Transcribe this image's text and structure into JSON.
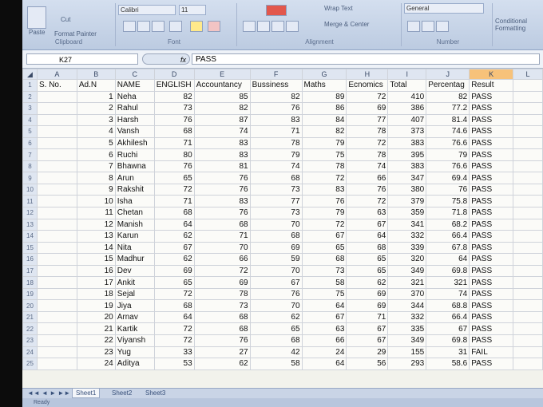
{
  "ribbon": {
    "paste": "Paste",
    "cut": "Cut",
    "format_painter": "Format Painter",
    "clipboard": "Clipboard",
    "font_name": "Calibri",
    "font_size": "11",
    "font_group": "Font",
    "wrap_text": "Wrap Text",
    "merge_center": "Merge & Center",
    "alignment": "Alignment",
    "number_format": "General",
    "number_group": "Number",
    "conditional_formatting": "Conditional Formatting"
  },
  "formula_bar": {
    "cell_ref": "K27",
    "fx": "fx",
    "content": "PASS"
  },
  "sheet": {
    "columns": [
      "A",
      "B",
      "C",
      "D",
      "E",
      "F",
      "G",
      "H",
      "I",
      "J",
      "K",
      "L"
    ],
    "selected_column": "K",
    "rows": [
      {
        "n": "1",
        "a": "S. No.",
        "b": "Ad.N",
        "c": "NAME",
        "d": "ENGLISH",
        "e": "Accountancy",
        "f": "Bussiness",
        "g": "Maths",
        "h": "Ecnomics",
        "i": "Total",
        "j": "Percentag",
        "k": "Result"
      },
      {
        "n": "2",
        "a": "",
        "b": "1",
        "c": "Neha",
        "d": "82",
        "e": "85",
        "f": "82",
        "g": "89",
        "h": "72",
        "i": "410",
        "j": "82",
        "k": "PASS"
      },
      {
        "n": "3",
        "a": "",
        "b": "2",
        "c": "Rahul",
        "d": "73",
        "e": "82",
        "f": "76",
        "g": "86",
        "h": "69",
        "i": "386",
        "j": "77.2",
        "k": "PASS"
      },
      {
        "n": "4",
        "a": "",
        "b": "3",
        "c": "Harsh",
        "d": "76",
        "e": "87",
        "f": "83",
        "g": "84",
        "h": "77",
        "i": "407",
        "j": "81.4",
        "k": "PASS"
      },
      {
        "n": "5",
        "a": "",
        "b": "4",
        "c": "Vansh",
        "d": "68",
        "e": "74",
        "f": "71",
        "g": "82",
        "h": "78",
        "i": "373",
        "j": "74.6",
        "k": "PASS"
      },
      {
        "n": "6",
        "a": "",
        "b": "5",
        "c": "Akhilesh",
        "d": "71",
        "e": "83",
        "f": "78",
        "g": "79",
        "h": "72",
        "i": "383",
        "j": "76.6",
        "k": "PASS"
      },
      {
        "n": "7",
        "a": "",
        "b": "6",
        "c": "Ruchi",
        "d": "80",
        "e": "83",
        "f": "79",
        "g": "75",
        "h": "78",
        "i": "395",
        "j": "79",
        "k": "PASS"
      },
      {
        "n": "8",
        "a": "",
        "b": "7",
        "c": "Bhawna",
        "d": "76",
        "e": "81",
        "f": "74",
        "g": "78",
        "h": "74",
        "i": "383",
        "j": "76.6",
        "k": "PASS"
      },
      {
        "n": "9",
        "a": "",
        "b": "8",
        "c": "Arun",
        "d": "65",
        "e": "76",
        "f": "68",
        "g": "72",
        "h": "66",
        "i": "347",
        "j": "69.4",
        "k": "PASS"
      },
      {
        "n": "10",
        "a": "",
        "b": "9",
        "c": "Rakshit",
        "d": "72",
        "e": "76",
        "f": "73",
        "g": "83",
        "h": "76",
        "i": "380",
        "j": "76",
        "k": "PASS"
      },
      {
        "n": "11",
        "a": "",
        "b": "10",
        "c": "Isha",
        "d": "71",
        "e": "83",
        "f": "77",
        "g": "76",
        "h": "72",
        "i": "379",
        "j": "75.8",
        "k": "PASS"
      },
      {
        "n": "12",
        "a": "",
        "b": "11",
        "c": "Chetan",
        "d": "68",
        "e": "76",
        "f": "73",
        "g": "79",
        "h": "63",
        "i": "359",
        "j": "71.8",
        "k": "PASS"
      },
      {
        "n": "13",
        "a": "",
        "b": "12",
        "c": "Manish",
        "d": "64",
        "e": "68",
        "f": "70",
        "g": "72",
        "h": "67",
        "i": "341",
        "j": "68.2",
        "k": "PASS"
      },
      {
        "n": "14",
        "a": "",
        "b": "13",
        "c": "Karun",
        "d": "62",
        "e": "71",
        "f": "68",
        "g": "67",
        "h": "64",
        "i": "332",
        "j": "66.4",
        "k": "PASS"
      },
      {
        "n": "15",
        "a": "",
        "b": "14",
        "c": "Nita",
        "d": "67",
        "e": "70",
        "f": "69",
        "g": "65",
        "h": "68",
        "i": "339",
        "j": "67.8",
        "k": "PASS"
      },
      {
        "n": "16",
        "a": "",
        "b": "15",
        "c": "Madhur",
        "d": "62",
        "e": "66",
        "f": "59",
        "g": "68",
        "h": "65",
        "i": "320",
        "j": "64",
        "k": "PASS"
      },
      {
        "n": "17",
        "a": "",
        "b": "16",
        "c": "Dev",
        "d": "69",
        "e": "72",
        "f": "70",
        "g": "73",
        "h": "65",
        "i": "349",
        "j": "69.8",
        "k": "PASS"
      },
      {
        "n": "18",
        "a": "",
        "b": "17",
        "c": "Ankit",
        "d": "65",
        "e": "69",
        "f": "67",
        "g": "58",
        "h": "62",
        "i": "321",
        "j": "321",
        "k": "PASS"
      },
      {
        "n": "19",
        "a": "",
        "b": "18",
        "c": "Sejal",
        "d": "72",
        "e": "78",
        "f": "76",
        "g": "75",
        "h": "69",
        "i": "370",
        "j": "74",
        "k": "PASS"
      },
      {
        "n": "20",
        "a": "",
        "b": "19",
        "c": "Jiya",
        "d": "68",
        "e": "73",
        "f": "70",
        "g": "64",
        "h": "69",
        "i": "344",
        "j": "68.8",
        "k": "PASS"
      },
      {
        "n": "21",
        "a": "",
        "b": "20",
        "c": "Arnav",
        "d": "64",
        "e": "68",
        "f": "62",
        "g": "67",
        "h": "71",
        "i": "332",
        "j": "66.4",
        "k": "PASS"
      },
      {
        "n": "22",
        "a": "",
        "b": "21",
        "c": "Kartik",
        "d": "72",
        "e": "68",
        "f": "65",
        "g": "63",
        "h": "67",
        "i": "335",
        "j": "67",
        "k": "PASS"
      },
      {
        "n": "23",
        "a": "",
        "b": "22",
        "c": "Viyansh",
        "d": "72",
        "e": "76",
        "f": "68",
        "g": "66",
        "h": "67",
        "i": "349",
        "j": "69.8",
        "k": "PASS"
      },
      {
        "n": "24",
        "a": "",
        "b": "23",
        "c": "Yug",
        "d": "33",
        "e": "27",
        "f": "42",
        "g": "24",
        "h": "29",
        "i": "155",
        "j": "31",
        "k": "FAIL"
      },
      {
        "n": "25",
        "a": "",
        "b": "24",
        "c": "Aditya",
        "d": "53",
        "e": "62",
        "f": "58",
        "g": "64",
        "h": "56",
        "i": "293",
        "j": "58.6",
        "k": "PASS"
      }
    ]
  },
  "tabs": [
    "Sheet1",
    "Sheet2",
    "Sheet3"
  ],
  "status": "Ready",
  "colors": {
    "selected_header": "#f7c27a",
    "ribbon": "#c8d6ea"
  }
}
